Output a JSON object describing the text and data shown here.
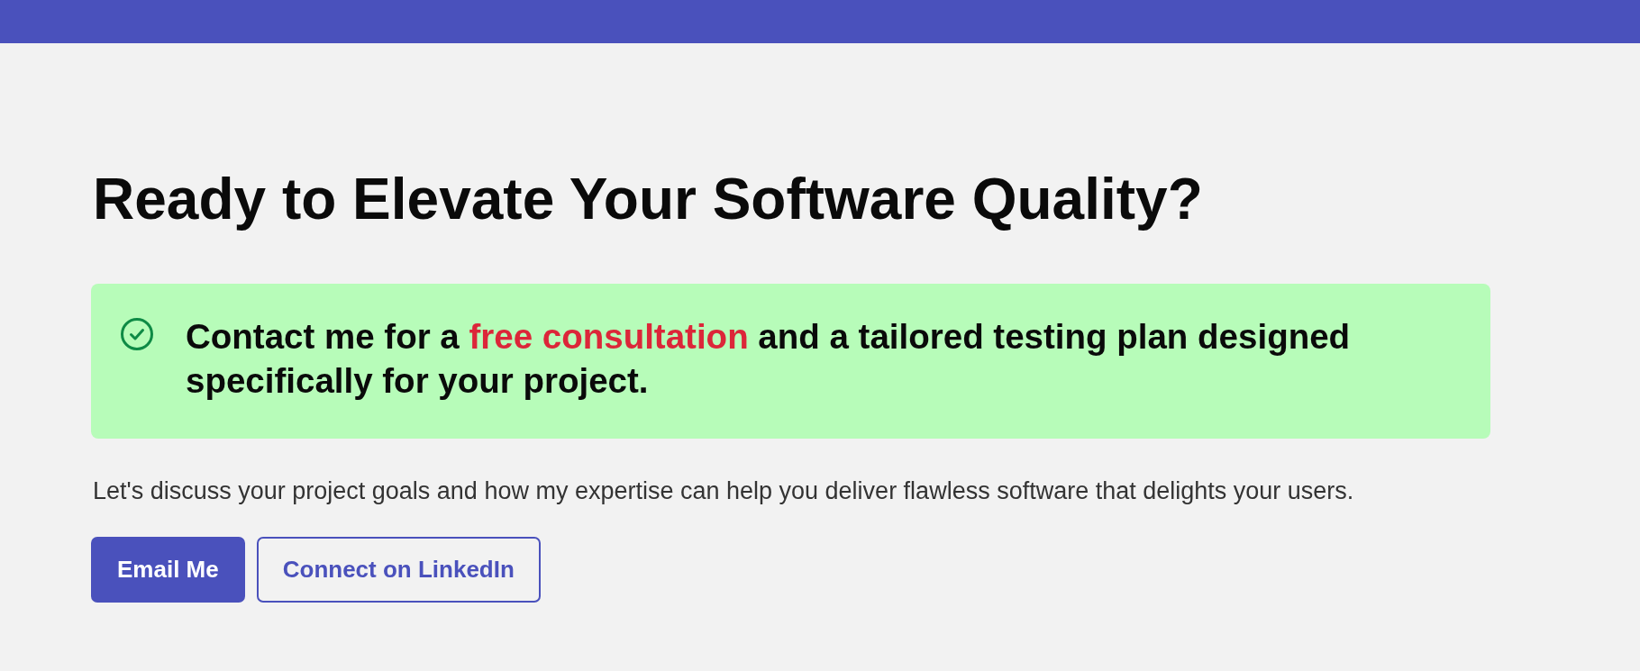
{
  "heading": "Ready to Elevate Your Software Quality?",
  "callout": {
    "segments": [
      {
        "text": "Contact me for a ",
        "highlight": false
      },
      {
        "text": "free consultation",
        "highlight": true
      },
      {
        "text": " and a tailored testing plan designed specifically for your project.",
        "highlight": false
      }
    ]
  },
  "description": "Let's discuss your project goals and how my expertise can help you deliver flawless software that delights your users.",
  "buttons": [
    {
      "label": "Email Me",
      "kind": "primary"
    },
    {
      "label": "Connect on LinkedIn",
      "kind": "outline"
    }
  ]
}
